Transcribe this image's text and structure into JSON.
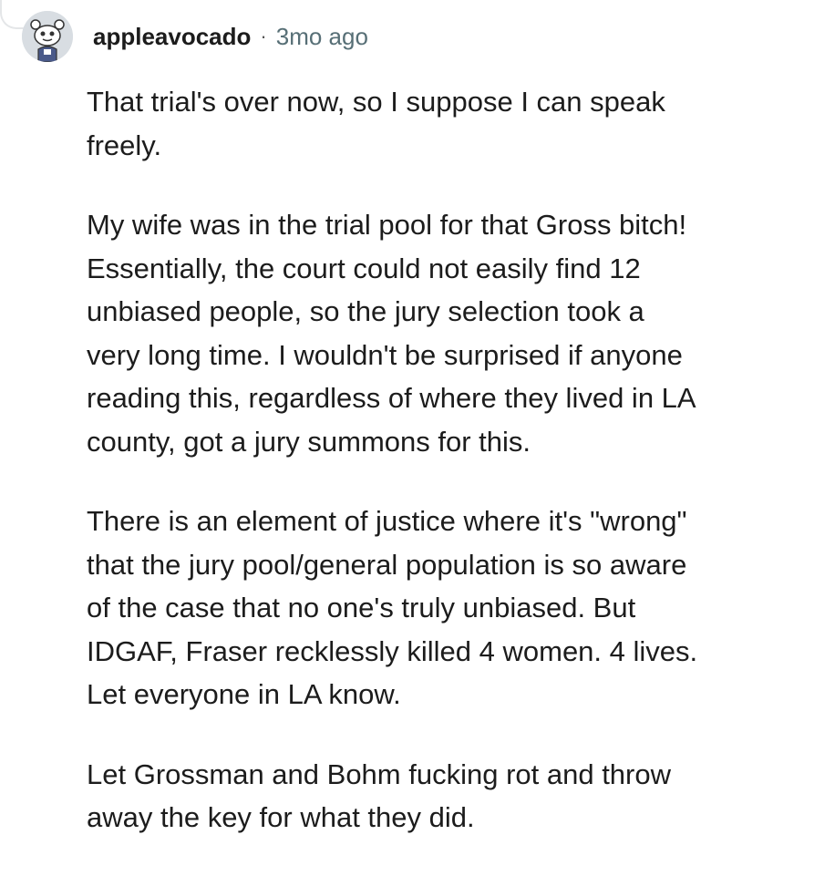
{
  "comment": {
    "author": {
      "username": "appleavocado",
      "avatar_icon": "snoo-avatar-icon"
    },
    "separator": "·",
    "timestamp": "3mo ago",
    "paragraphs": [
      [
        "That trial's over now, so I suppose I can speak",
        "freely."
      ],
      [
        "My wife was in the trial pool for that Gross bitch!",
        "Essentially, the court could not easily find 12",
        "unbiased people, so the jury selection took a",
        "very long time. I wouldn't be surprised if anyone",
        "reading this, regardless of where they lived in LA",
        "county, got a jury summons for this."
      ],
      [
        "There is an element of justice where it's \"wrong\"",
        "that the jury pool/general population is so aware",
        "of the case that no one's truly unbiased. But",
        "IDGAF, Fraser recklessly killed 4 women. 4 lives.",
        "Let everyone in LA know."
      ],
      [
        "Let Grossman and Bohm fucking rot and throw",
        "away the key for what they did."
      ]
    ]
  }
}
